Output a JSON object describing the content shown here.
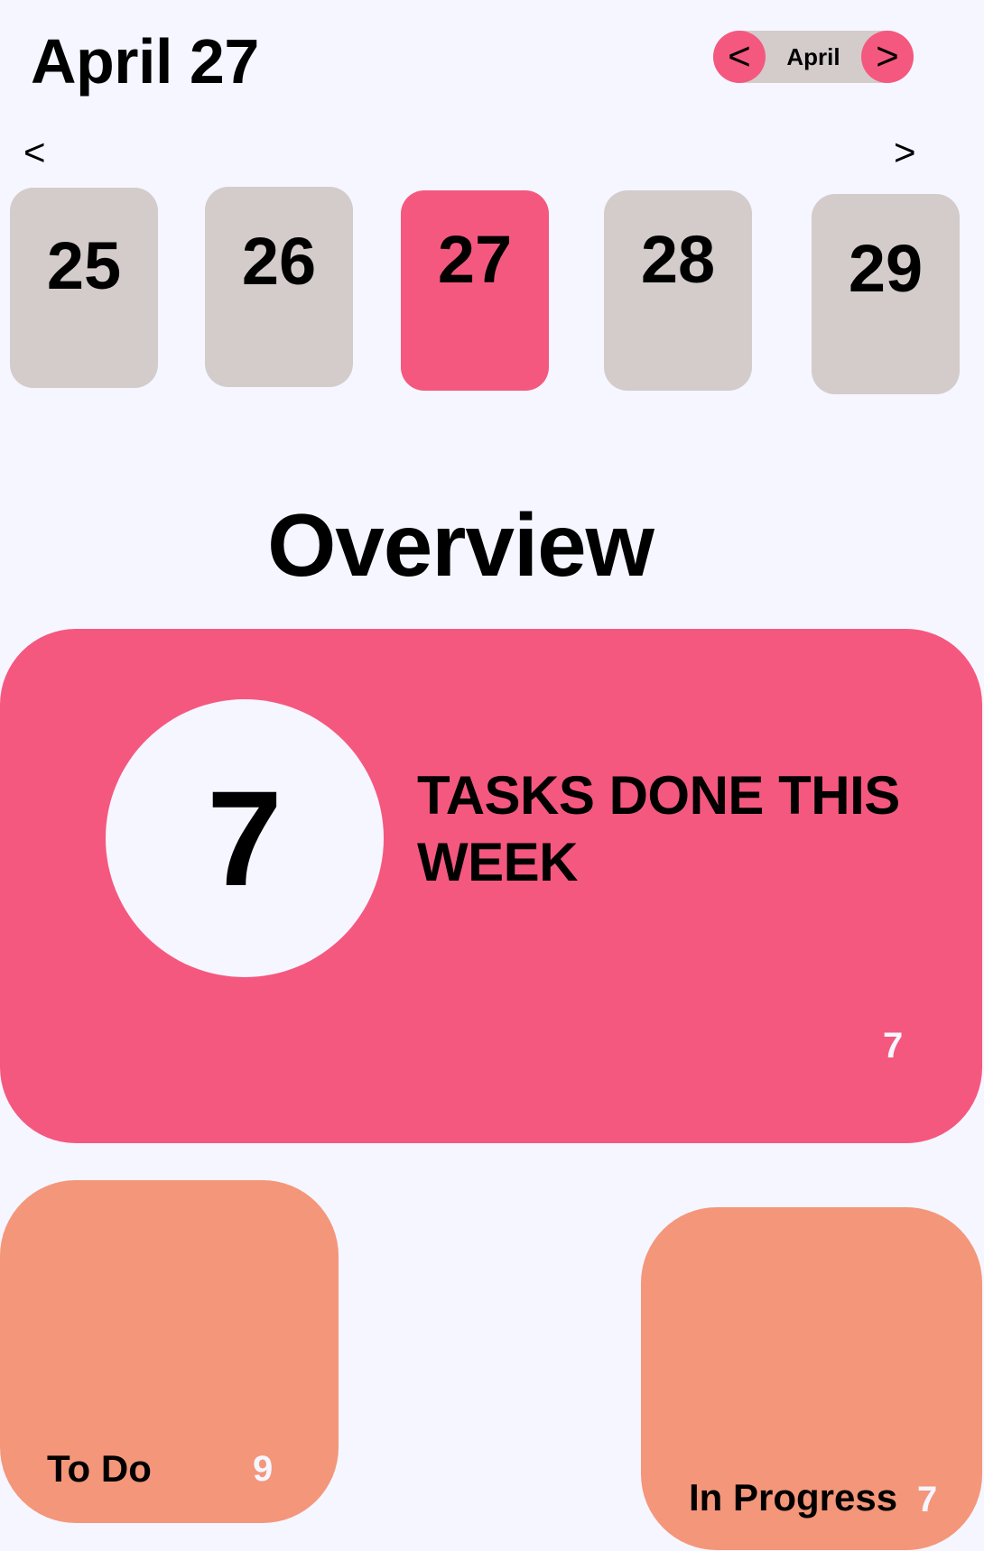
{
  "header": {
    "date_title": "April 27",
    "month_switcher": {
      "prev": "<",
      "month": "April",
      "next": ">"
    }
  },
  "day_strip": {
    "prev": "<",
    "next": ">",
    "days": [
      {
        "label": "25",
        "selected": false
      },
      {
        "label": "26",
        "selected": false
      },
      {
        "label": "27",
        "selected": true
      },
      {
        "label": "28",
        "selected": false
      },
      {
        "label": "29",
        "selected": false
      }
    ]
  },
  "overview": {
    "title": "Overview",
    "summary": {
      "count": "7",
      "text": "TASKS DONE THIS WEEK",
      "secondary_count": "7"
    },
    "todo": {
      "label": "To Do",
      "count": "9"
    },
    "in_progress": {
      "label": "In Progress",
      "count": "7"
    }
  },
  "colors": {
    "background": "#f5f6ff",
    "accent": "#f5587f",
    "muted_card": "#d3cccb",
    "status_card": "#f4967a"
  }
}
